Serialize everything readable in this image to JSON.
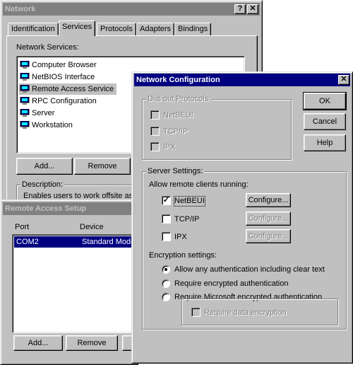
{
  "network": {
    "title": "Network",
    "help_button": "?",
    "close_button": "✕",
    "tabs": [
      "Identification",
      "Services",
      "Protocols",
      "Adapters",
      "Bindings"
    ],
    "services_label": "Network Services:",
    "services": [
      "Computer Browser",
      "NetBIOS Interface",
      "Remote Access Service",
      "RPC Configuration",
      "Server",
      "Workstation"
    ],
    "selected_service": "Remote Access Service",
    "add_button": "Add...",
    "remove_button": "Remove",
    "description_label": "Description:",
    "description_text": "Enables users to work offsite as l"
  },
  "ras_setup": {
    "title": "Remote Access Setup",
    "columns": [
      "Port",
      "Device"
    ],
    "rows": [
      {
        "port": "COM2",
        "device": "Standard Mode"
      }
    ],
    "add_button": "Add...",
    "remove_button": "Remove"
  },
  "net_config": {
    "title": "Network Configuration",
    "close_button": "✕",
    "dialout_label": "Dial out Protocols:",
    "dialout": [
      "NetBEUI",
      "TCP/IP",
      "IPX"
    ],
    "ok_button": "OK",
    "cancel_button": "Cancel",
    "help_button": "Help",
    "server_settings_label": "Server Settings:",
    "allow_label": "Allow remote clients running:",
    "server_protocols": [
      {
        "label": "NetBEUI",
        "checked": true,
        "configure": "Configure...",
        "configure_enabled": true
      },
      {
        "label": "TCP/IP",
        "checked": false,
        "configure": "Configure...",
        "configure_enabled": false
      },
      {
        "label": "IPX",
        "checked": false,
        "configure": "Configure...",
        "configure_enabled": false
      }
    ],
    "encryption_label": "Encryption settings:",
    "encryption_options": [
      "Allow any authentication including clear text",
      "Require encrypted authentication",
      "Require Microsoft encrypted authentication"
    ],
    "selected_encryption": 0,
    "require_data_encryption": "Require data encryption"
  },
  "colors": {
    "face": "#c0c0c0",
    "active_title": "#000080",
    "inactive_title": "#808080",
    "selection": "#000080"
  }
}
